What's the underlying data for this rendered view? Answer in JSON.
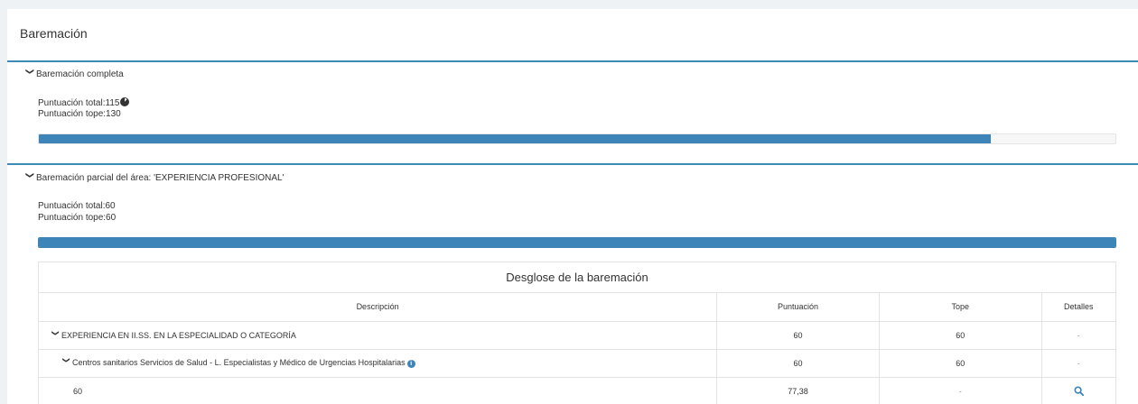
{
  "page": {
    "title": "Baremación"
  },
  "complete": {
    "header": "Baremación completa",
    "total_label": "Puntuación total:115",
    "top_label": "Puntuación tope:130",
    "progress_fraction": 0.8846
  },
  "partial": {
    "header": "Baremación parcial del área: 'EXPERIENCIA PROFESIONAL'",
    "total_label": "Puntuación total:60",
    "top_label": "Puntuación tope:60",
    "progress_fraction": 1.0
  },
  "breakdown": {
    "title": "Desglose de la baremación",
    "columns": [
      "Descripción",
      "Puntuación",
      "Tope",
      "Detalles"
    ],
    "rows": [
      {
        "description": "EXPERIENCIA EN II.SS. EN LA ESPECIALIDAD O CATEGORÍA",
        "score": "60",
        "cap": "60",
        "details": "-"
      },
      {
        "description": "Centros sanitarios Servicios de Salud - L. Especialistas y Médico de Urgencias Hospitalarias",
        "score": "60",
        "cap": "60",
        "details": "-"
      },
      {
        "description": "60",
        "score": "77,38",
        "cap": "-",
        "details": ""
      }
    ]
  },
  "icons": {
    "chevron": "chevron-down-icon",
    "pie": "pie-chart-icon",
    "info": "info-icon",
    "search": "search-icon"
  },
  "colors": {
    "accent": "#3d85b8",
    "divider": "#3d8ab8"
  }
}
